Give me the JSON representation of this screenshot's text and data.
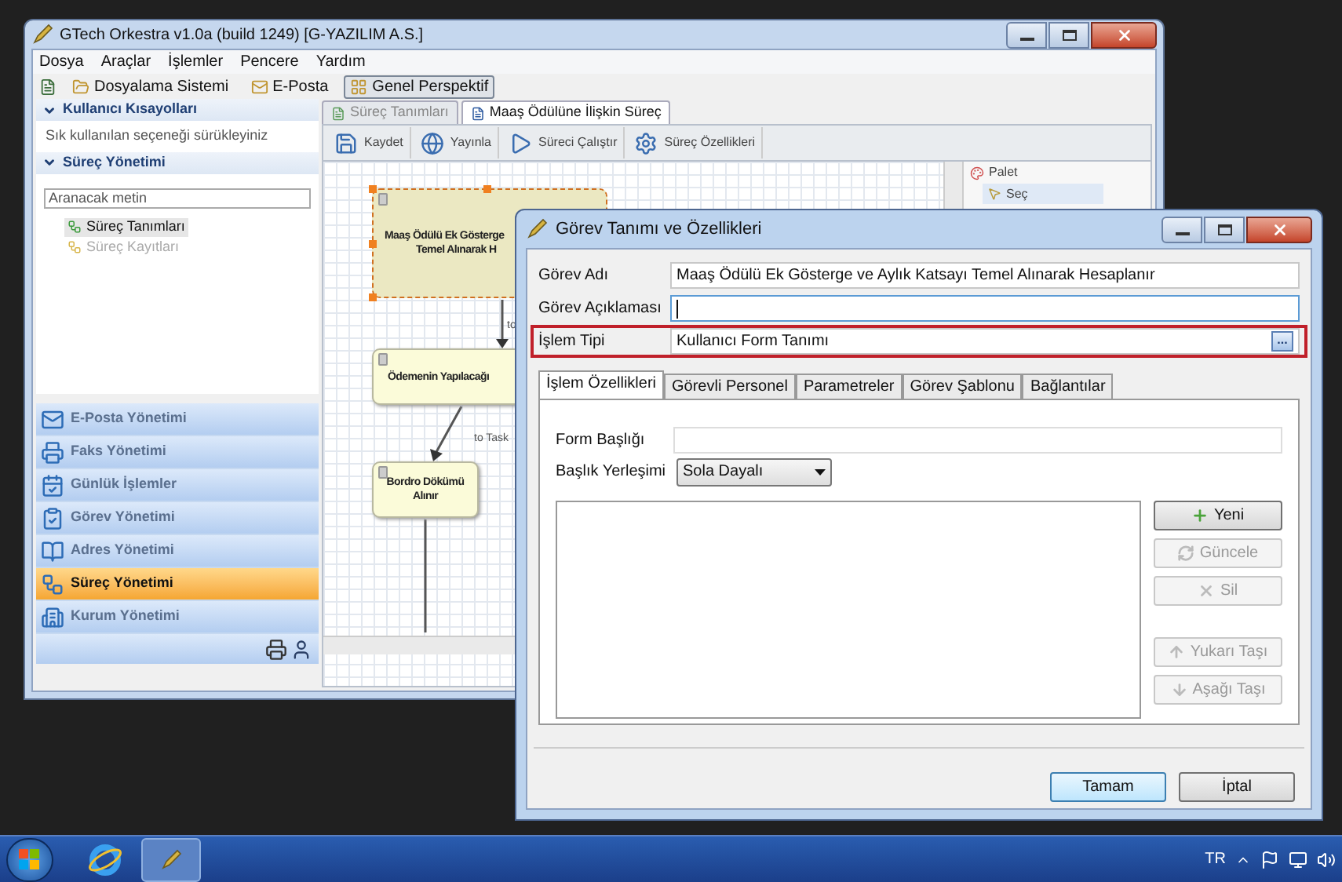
{
  "main_window": {
    "title": "GTech Orkestra v1.0a (build 1249) [G-YAZILIM A.S.]",
    "menu": [
      "Dosya",
      "Araçlar",
      "İşlemler",
      "Pencere",
      "Yardım"
    ],
    "toolbar": [
      {
        "label": "Dosyalama Sistemi",
        "selected": false
      },
      {
        "label": "E-Posta",
        "selected": false
      },
      {
        "label": "Genel Perspektif",
        "selected": true
      }
    ],
    "shortcuts": {
      "title": "Kullanıcı Kısayolları",
      "hint": "Sık kullanılan seçeneği sürükleyiniz"
    },
    "process": {
      "title": "Süreç Yönetimi",
      "search": {
        "placeholder": "Aranacak metin"
      },
      "items": [
        {
          "label": "Süreç Tanımları",
          "selected": true,
          "disabled": false
        },
        {
          "label": "Süreç Kayıtları",
          "selected": false,
          "disabled": true
        }
      ]
    },
    "nav": [
      {
        "label": "E-Posta Yönetimi",
        "selected": false
      },
      {
        "label": "Faks Yönetimi",
        "selected": false
      },
      {
        "label": "Günlük İşlemler",
        "selected": false
      },
      {
        "label": "Görev Yönetimi",
        "selected": false
      },
      {
        "label": "Adres Yönetimi",
        "selected": false
      },
      {
        "label": "Süreç Yönetimi",
        "selected": true
      },
      {
        "label": "Kurum Yönetimi",
        "selected": false
      }
    ],
    "editor": {
      "tabs": [
        {
          "label": "Süreç Tanımları",
          "selected": false
        },
        {
          "label": "Maaş Ödülüne İlişkin Süreç",
          "selected": true
        }
      ],
      "toolbar": [
        "Kaydet",
        "Yayınla",
        "Süreci Çalıştır",
        "Süreç Özellikleri"
      ],
      "nodes": [
        {
          "lines": [
            "Maaş Ödülü Ek Gösterge",
            "Temel Alınarak H"
          ],
          "selected": true
        },
        {
          "lines": [
            "Ödemenin Yapılacağı"
          ],
          "selected": false
        },
        {
          "lines": [
            "Bordro Dökümü",
            "Alınır"
          ],
          "selected": false
        }
      ],
      "edges": [
        {
          "label": "to"
        },
        {
          "label": "to Task"
        }
      ],
      "palette": {
        "title": "Palet",
        "items": [
          "Seç"
        ]
      }
    }
  },
  "dialog": {
    "title": "Görev Tanımı ve Özellikleri",
    "fields": [
      {
        "kind": "text",
        "label": "Görev Adı",
        "value": "Maaş Ödülü Ek Gösterge ve Aylık Katsayı Temel Alınarak Hesaplanır",
        "focused": false,
        "highlighted": false
      },
      {
        "kind": "text",
        "label": "Görev Açıklaması",
        "focused": true,
        "highlighted": false
      },
      {
        "kind": "picker",
        "label": "İşlem Tipi",
        "value": "Kullanıcı Form Tanımı",
        "button": "...",
        "focused": false,
        "highlighted": true
      }
    ],
    "tabs": [
      {
        "label": "İşlem Özellikleri",
        "selected": true
      },
      {
        "label": "Görevli Personel",
        "selected": false
      },
      {
        "label": "Parametreler",
        "selected": false
      },
      {
        "label": "Görev Şablonu",
        "selected": false
      },
      {
        "label": "Bağlantılar",
        "selected": false
      }
    ],
    "form_title": {
      "label": "Form Başlığı"
    },
    "title_placement": {
      "label": "Başlık Yerleşimi",
      "value": "Sola Dayalı"
    },
    "side_buttons": [
      {
        "label": "Yeni",
        "disabled": false
      },
      {
        "label": "Güncele",
        "disabled": true
      },
      {
        "label": "Sil",
        "disabled": true
      },
      {
        "label": "Yukarı Taşı",
        "disabled": true
      },
      {
        "label": "Aşağı Taşı",
        "disabled": true
      }
    ],
    "buttons": [
      {
        "label": "Tamam",
        "default": true
      },
      {
        "label": "İptal",
        "default": false
      }
    ]
  },
  "taskbar": {
    "language": "TR"
  }
}
